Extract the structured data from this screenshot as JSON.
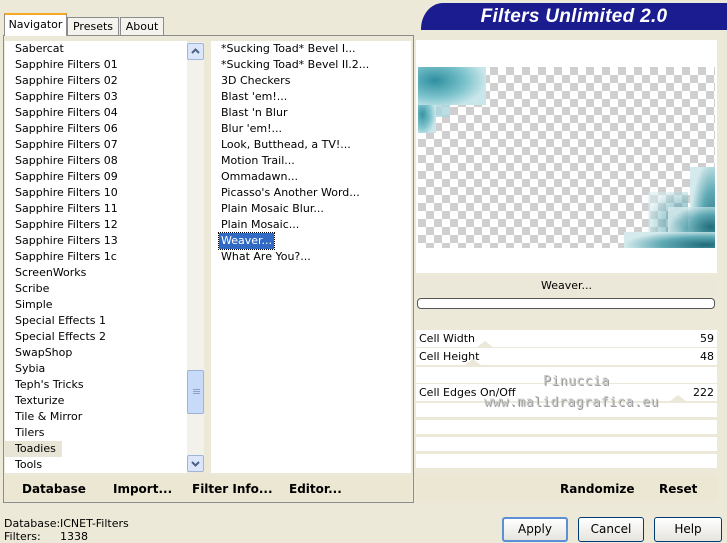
{
  "tabs": [
    "Navigator",
    "Presets",
    "About"
  ],
  "banner_title": "Filters Unlimited 2.0",
  "categories": [
    "Sabercat",
    "Sapphire Filters 01",
    "Sapphire Filters 02",
    "Sapphire Filters 03",
    "Sapphire Filters 04",
    "Sapphire Filters 06",
    "Sapphire Filters 07",
    "Sapphire Filters 08",
    "Sapphire Filters 09",
    "Sapphire Filters 10",
    "Sapphire Filters 11",
    "Sapphire Filters 12",
    "Sapphire Filters 13",
    "Sapphire Filters 1c",
    "ScreenWorks",
    "Scribe",
    "Simple",
    "Special Effects 1",
    "Special Effects 2",
    "SwapShop",
    "Sybia",
    "Teph's Tricks",
    "Texturize",
    "Tile & Mirror",
    "Tilers",
    "Toadies",
    "Tools"
  ],
  "selected_category": "Toadies",
  "filters": [
    "*Sucking Toad*  Bevel I...",
    "*Sucking Toad*  Bevel II.2...",
    "3D Checkers",
    "Blast 'em!...",
    "Blast 'n Blur",
    "Blur 'em!...",
    "Look, Butthead, a TV!...",
    "Motion Trail...",
    "Ommadawn...",
    "Picasso's Another Word...",
    "Plain Mosaic Blur...",
    "Plain Mosaic...",
    "Weaver...",
    "What Are You?..."
  ],
  "selected_filter": "Weaver...",
  "preview_name": "Weaver...",
  "params": [
    {
      "name": "Cell Width",
      "value": "59",
      "slider": 0.23
    },
    {
      "name": "Cell Height",
      "value": "48",
      "slider": 0.19
    },
    {
      "name": "Cell Edges On/Off",
      "value": "222",
      "slider": 0.87
    }
  ],
  "watermark": [
    "Pinuccia",
    "www.malidragrafica.eu"
  ],
  "left_actions": [
    "Database",
    "Import...",
    "Filter Info...",
    "Editor..."
  ],
  "right_actions": [
    "Randomize",
    "Reset"
  ],
  "status": {
    "db_label": "Database:",
    "db_value": "ICNET-Filters",
    "filters_label": "Filters:",
    "filters_value": "1338"
  },
  "buttons": {
    "apply": "Apply",
    "cancel": "Cancel",
    "help": "Help"
  },
  "colors": {
    "banner": "#1a1c8f",
    "selection": "#316ac5",
    "teal": "#2d8a9a",
    "accent_tab": "#f5a623"
  }
}
